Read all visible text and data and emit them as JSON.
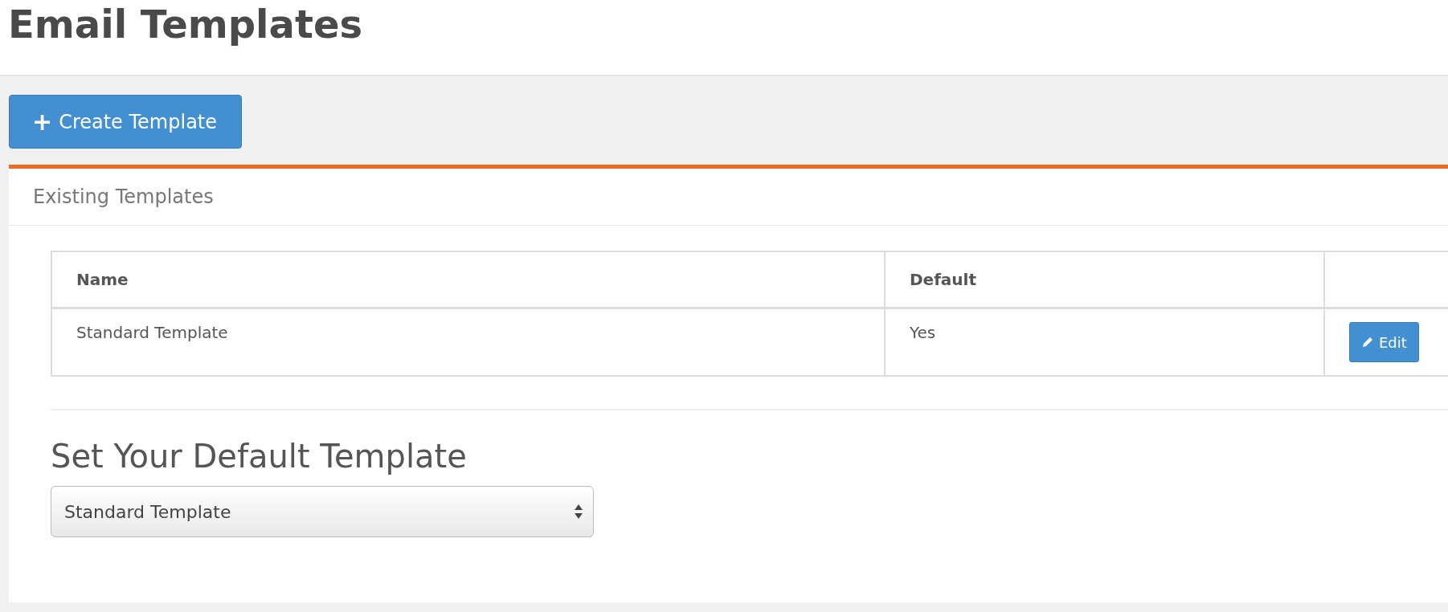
{
  "page_title": "Email Templates",
  "create_button": {
    "icon": "+",
    "label": "Create Template"
  },
  "panel": {
    "title": "Existing Templates",
    "table": {
      "columns": [
        "Name",
        "Default"
      ],
      "rows": [
        {
          "name": "Standard Template",
          "default": "Yes",
          "action": "Edit"
        }
      ]
    }
  },
  "default_section": {
    "heading": "Set Your Default Template",
    "select": {
      "value": "Standard Template"
    }
  }
}
